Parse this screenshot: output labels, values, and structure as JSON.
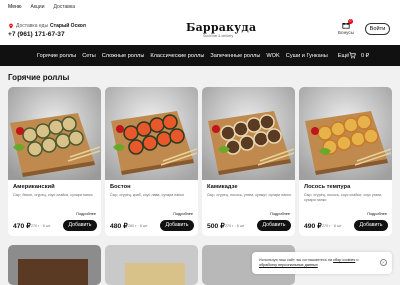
{
  "topbar": {
    "items": [
      "Меню",
      "Акции",
      "Доставка"
    ]
  },
  "header": {
    "delivery_prefix": "Доставка еды",
    "city": "Старый Оскол",
    "phone": "+7 (961) 171-67-37",
    "logo": "Барракуда",
    "logo_sub": "Sushi bar & delivery",
    "bonus_label": "Бонусы",
    "bonus_count": "0",
    "login_label": "Войти"
  },
  "nav": {
    "items": [
      "Горячие роллы",
      "Сеты",
      "Сложные роллы",
      "Классические роллы",
      "Запеченные роллы",
      "WOK",
      "Суши и Гунканы"
    ],
    "more": "Ещё",
    "cart_total": "0 ₽"
  },
  "section_title": "Горячие роллы",
  "products": [
    {
      "name": "Американский",
      "desc": "Сыр, бекон, огурец, соус спайси, сухари панко",
      "more": "Подробнее",
      "price": "470 ₽",
      "weight": "270 г · 8 шт",
      "add": "Добавить"
    },
    {
      "name": "Бостон",
      "desc": "Сыр, огурец, краб, соус лава, сухари панко",
      "more": "Подробнее",
      "price": "480 ₽",
      "weight": "280 г · 8 шт",
      "add": "Добавить"
    },
    {
      "name": "Камикадзе",
      "desc": "Сыр, огурец, лосось, унаги, кунжут, сухари панко",
      "more": "Подробнее",
      "price": "500 ₽",
      "weight": "270 г · 8 шт",
      "add": "Добавить"
    },
    {
      "name": "Лосось темпура",
      "desc": "Сыр, огурец, лосось, соус спайси, соус унаги, сухари панко",
      "more": "Подробнее",
      "price": "490 ₽",
      "weight": "270 г · 8 шт",
      "add": "Добавить"
    }
  ],
  "cookie": {
    "text": "Используя наш сайт, вы соглашаетесь на",
    "link1": "сбор cookies",
    "and": " и ",
    "link2": "обработку персональных данных",
    "close": "×"
  },
  "colors": {
    "nav_bg": "#111111",
    "accent": "#e30613",
    "button_bg": "#111111",
    "page_bg": "#f1f1f1"
  }
}
